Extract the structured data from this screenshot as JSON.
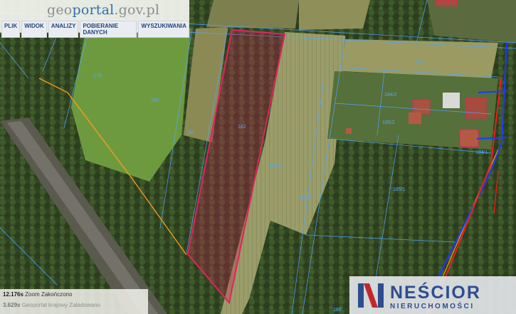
{
  "header": {
    "logo": {
      "part1": "geo",
      "part2": "portal",
      "part3": ".gov.pl"
    },
    "menu": [
      "PLIK",
      "WIDOK",
      "ANALIZY",
      "POBIERANIE DANYCH",
      "WYSZUKIWANIA"
    ]
  },
  "status": {
    "row1": {
      "time": "12.176s",
      "layer": "Zoom",
      "state": "Zakończono"
    },
    "row2": {
      "time": "3.629s",
      "layer": "Geoportal krajowy",
      "state": "Załadowano"
    }
  },
  "brand": {
    "name": "NEŚCIOR",
    "sub": "NIERUCHOMOŚCI"
  },
  "parcels": [
    "179",
    "180",
    "181",
    "182",
    "183/1",
    "183/2",
    "184/2",
    "185/1",
    "185/2",
    "186",
    "184/1",
    "183"
  ],
  "colors": {
    "highlight": "#e0245e",
    "parcel_line": "#4fa6ff",
    "power_line": "#ff9a1a",
    "road_red": "#ff1a1a",
    "road_blue": "#1a3cff"
  }
}
